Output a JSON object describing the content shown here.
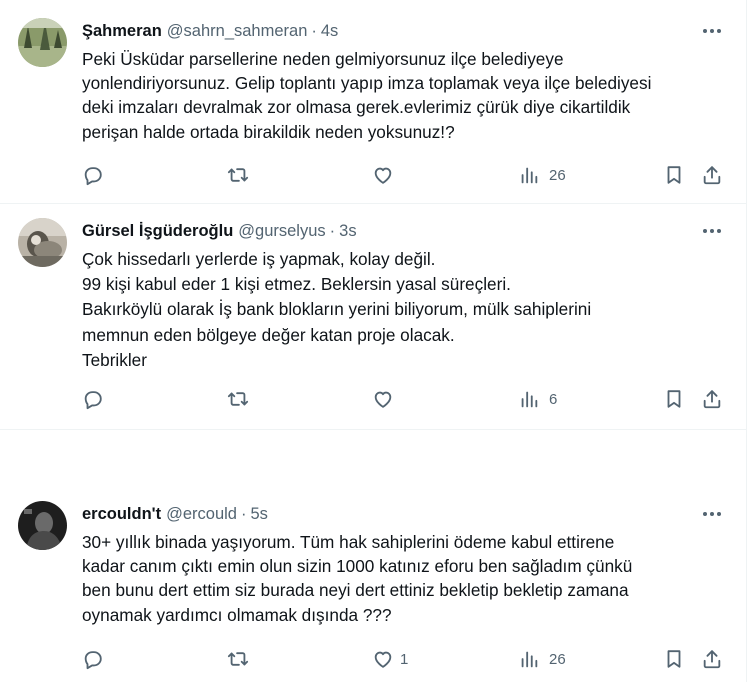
{
  "tweets": [
    {
      "name": "Şahmeran",
      "handle": "@sahrn_sahmeran",
      "separator": "·",
      "time": "4s",
      "lines": [
        "Peki Üsküdar parsellerine neden gelmiyorsunuz ilçe belediyeye",
        "yonlendiriyorsunuz. Gelip toplantı yapıp imza toplamak veya ilçe belediyesi",
        "deki imzaları devralmak zor olmasa gerek.evlerimiz çürük diye cikartildik",
        "perişan halde ortada birakildik neden yoksunuz!?"
      ],
      "replies": "",
      "retweets": "",
      "likes": "",
      "views": "26",
      "avatar_colors": [
        "#4a5a3c",
        "#a8b58a"
      ]
    },
    {
      "name": "Gürsel İşgüderoğlu",
      "handle": "@gurselyus",
      "separator": "·",
      "time": "3s",
      "lines": [
        "Çok hissedarlı yerlerde iş yapmak, kolay değil.",
        "99 kişi kabul eder 1 kişi etmez. Beklersin yasal süreçleri.",
        "Bakırköylü olarak İş bank blokların yerini biliyorum, mülk sahiplerini",
        "memnun eden bölgeye değer katan proje olacak.",
        "Tebrikler"
      ],
      "replies": "",
      "retweets": "",
      "likes": "",
      "views": "6",
      "avatar_colors": [
        "#6e6a60",
        "#c9c3b8"
      ]
    },
    {
      "name": "ercouldn't",
      "handle": "@ercould",
      "separator": "·",
      "time": "5s",
      "lines": [
        "30+ yıllık binada yaşıyorum. Tüm hak sahiplerini ödeme kabul ettirene",
        "kadar canım çıktı emin olun sizin 1000 katınız eforu ben sağladım çünkü",
        "ben bunu dert ettim siz burada neyi dert ettiniz bekletip bekletip zamana",
        "oynamak yardımcı olmamak dışında ???"
      ],
      "replies": "",
      "retweets": "",
      "likes": "1",
      "views": "26",
      "avatar_colors": [
        "#1e1e1e",
        "#7a7a7a"
      ]
    }
  ],
  "icons": {
    "more": "more-dots-icon",
    "reply": "reply-icon",
    "retweet": "retweet-icon",
    "like": "heart-icon",
    "views": "views-bar-chart-icon",
    "bookmark": "bookmark-icon",
    "share": "share-icon"
  },
  "colors": {
    "text": "#0f1419",
    "secondary": "#536471",
    "divider": "#eff3f4"
  }
}
